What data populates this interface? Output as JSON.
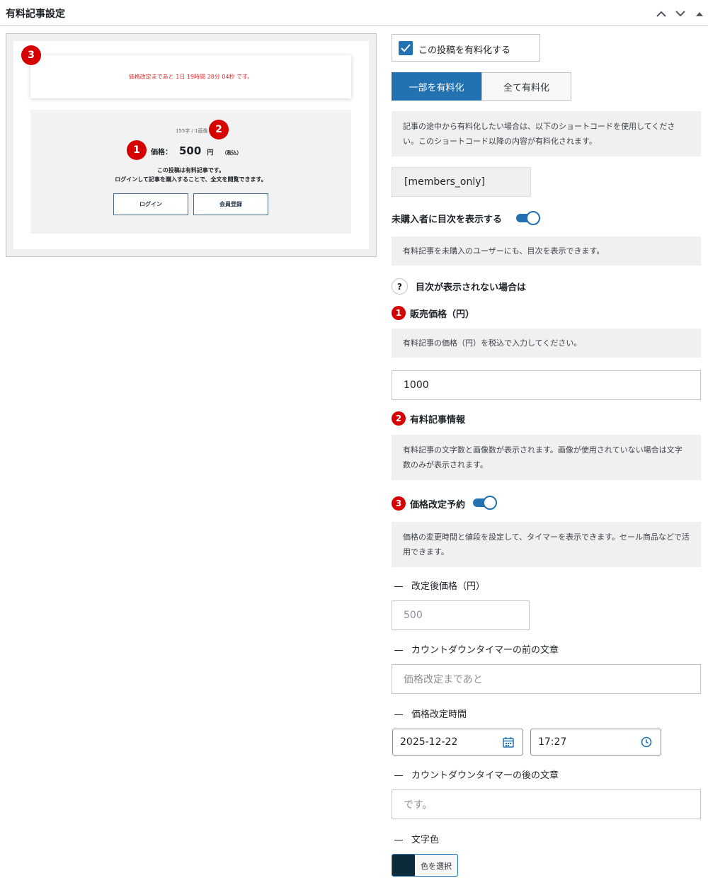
{
  "header": {
    "title": "有料記事設定",
    "buttons": [
      "chevron-up-icon",
      "chevron-down-icon",
      "triangle-up-icon"
    ]
  },
  "preview": {
    "timer_text": "価格改定まであと 1日 19時間 28分 04秒 です。",
    "stats_text": "155字 / 1画像",
    "price_label": "価格：",
    "price_value": "500",
    "price_unit": "円",
    "price_tax": "（税込）",
    "desc_line1": "この投稿は有料記事です。",
    "desc_line2": "ログインして記事を購入することで、全文を閲覧できます。",
    "login_button": "ログイン",
    "register_button": "会員登録",
    "badges": {
      "one": "1",
      "two": "2",
      "three": "3"
    },
    "accent_color": "#d50000"
  },
  "settings": {
    "paid_checkbox_label": "この投稿を有料化する",
    "paid_checked": true,
    "tabs": [
      "一部を有料化",
      "全て有料化"
    ],
    "active_tab": "一部を有料化",
    "shortcode_note": "記事の途中から有料化したい場合は、以下のショートコードを使用してください。このショートコード以降の内容が有料化されます。",
    "shortcode": "[members_only]",
    "toc_label": "未購入者に目次を表示する",
    "toc_enabled": true,
    "toc_note": "有料記事を未購入のユーザーにも、目次を表示できます。",
    "toc_help": "目次が表示されない場合は",
    "section1": {
      "num": "1",
      "label": "販売価格（円）",
      "note": "有料記事の価格（円）を税込で入力してください。",
      "value": "1000"
    },
    "section2": {
      "num": "2",
      "label": "有料記事情報",
      "note": "有料記事の文字数と画像数が表示されます。画像が使用されていない場合は文字数のみが表示されます。"
    },
    "section3": {
      "num": "3",
      "label": "価格改定予約",
      "enabled": true,
      "note": "価格の変更時間と値段を設定して、タイマーを表示できます。セール商品などで活用できます。"
    },
    "new_price_label": "改定後価格（円）",
    "new_price_placeholder": "500",
    "before_text_label": "カウントダウンタイマーの前の文章",
    "before_text_placeholder": "価格改定まであと",
    "change_time_label": "価格改定時間",
    "date_value": "2025-12-22",
    "time_value": "17:27",
    "after_text_label": "カウントダウンタイマーの後の文章",
    "after_text_placeholder": "です。",
    "text_color_label": "文字色",
    "color_button_label": "色を選択",
    "text_color_value": "#0b2a3a",
    "primary_color": "#2271b1"
  }
}
